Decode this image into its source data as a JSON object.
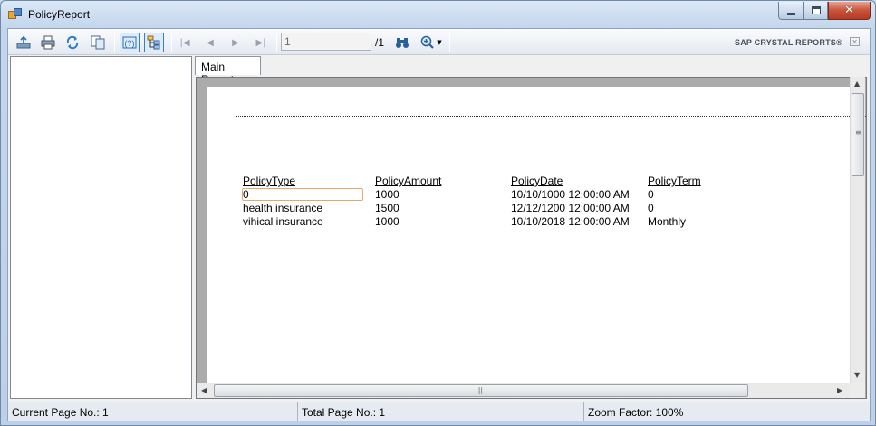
{
  "window": {
    "title": "PolicyReport"
  },
  "toolbar": {
    "buttons": [
      "export-icon",
      "print-icon",
      "refresh-icon",
      "copy-icon",
      "help-icon",
      "group-tree-icon"
    ],
    "nav": [
      "first-page-icon",
      "previous-page-icon",
      "next-page-icon",
      "last-page-icon"
    ],
    "page_input_value": "1",
    "page_total": "/1",
    "brand": "SAP CRYSTAL REPORTS®"
  },
  "tabs": [
    {
      "label": "Main Report"
    }
  ],
  "report": {
    "columns": [
      "PolicyType",
      "PolicyAmount",
      "PolicyDate",
      "PolicyTerm"
    ],
    "rows": [
      [
        "0",
        "1000",
        "10/10/1000 12:00:00 AM",
        "0"
      ],
      [
        "health insurance",
        "1500",
        "12/12/1200 12:00:00 AM",
        "0"
      ],
      [
        "vihical insurance",
        "1000",
        "10/10/2018 12:00:00 AM",
        "Monthly"
      ]
    ]
  },
  "statusbar": {
    "current_page": "Current Page No.: 1",
    "total_page": "Total Page No.: 1",
    "zoom": "Zoom Factor: 100%"
  },
  "colors": {
    "frame": "#c3d6ec",
    "close_button": "#c8533b",
    "viewer_background": "#ababab",
    "focus_border": "#e7a66b"
  }
}
